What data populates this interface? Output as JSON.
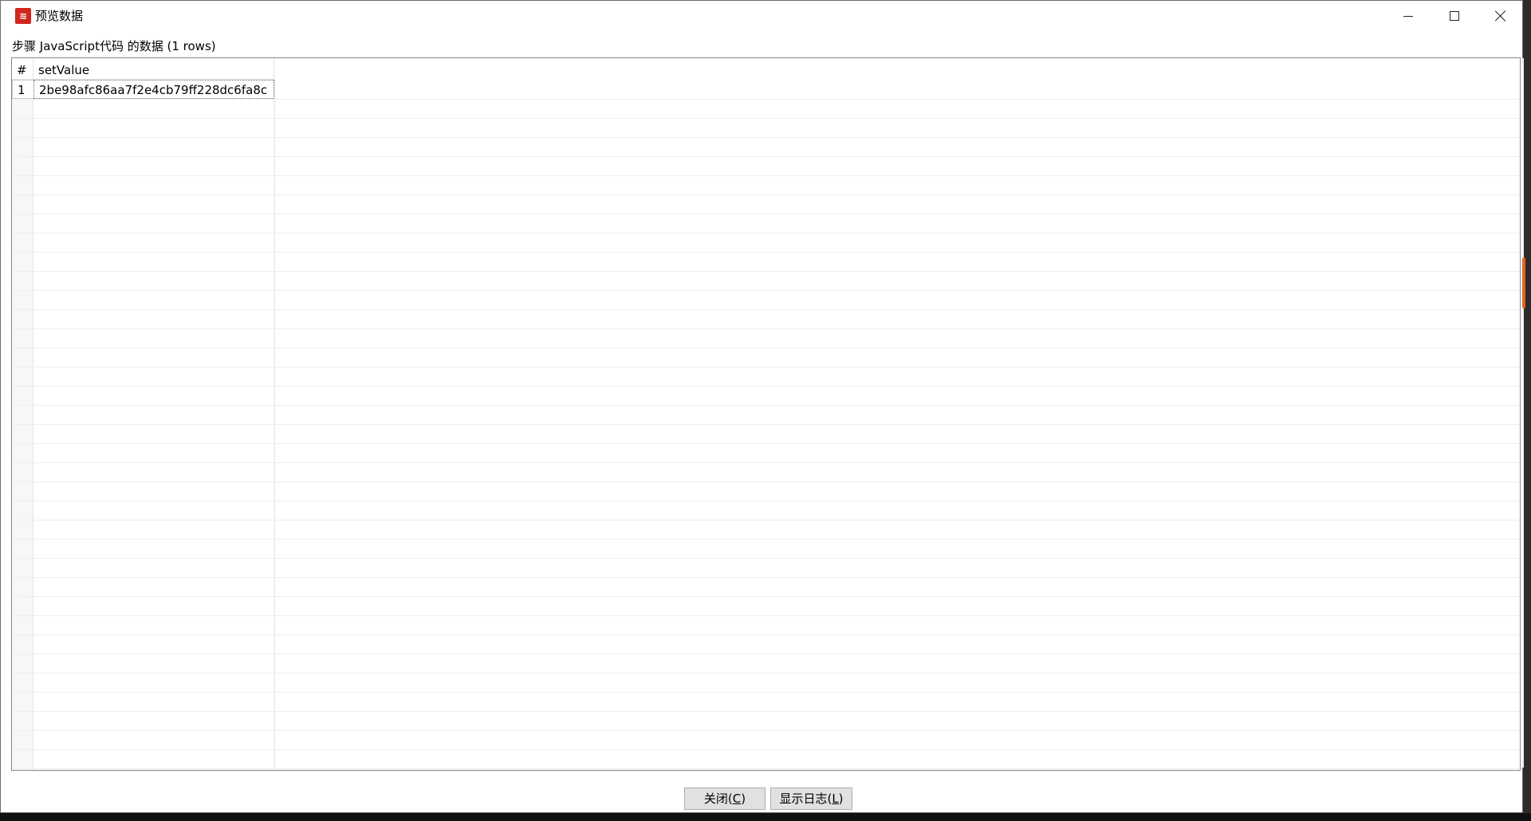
{
  "window": {
    "title": "预览数据",
    "icon_name": "app-logo-icon",
    "accent": "#d0261c"
  },
  "caption": "步骤 JavaScript代码 的数据  (1 rows)",
  "grid": {
    "columns": [
      "#",
      "setValue"
    ],
    "rows": [
      {
        "index": "1",
        "setValue": "2be98afc86aa7f2e4cb79ff228dc6fa8c"
      }
    ]
  },
  "buttons": {
    "close_label": "关闭(",
    "close_hotkey": "C",
    "close_suffix": ")",
    "log_label": "显示日志(",
    "log_hotkey": "L",
    "log_suffix": ")"
  },
  "colors": {
    "scrollbar_thumb": "#e8631f"
  }
}
